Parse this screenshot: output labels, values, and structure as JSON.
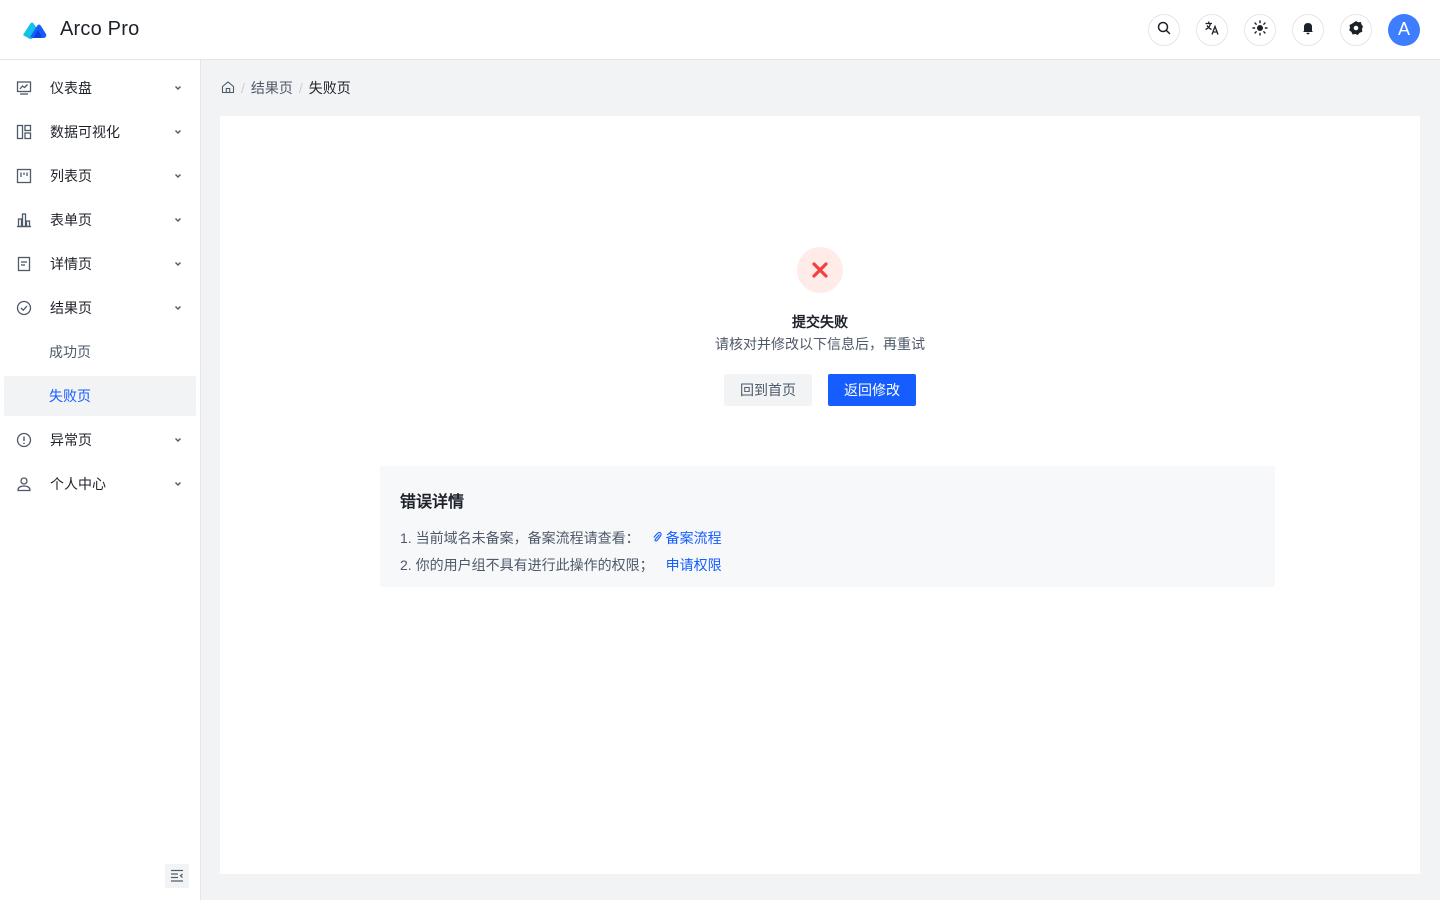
{
  "app": {
    "name": "Arco Pro",
    "avatar_letter": "A",
    "accent": "#165dff"
  },
  "toolbar": {
    "icons": [
      "search-icon",
      "translate-icon",
      "theme-icon",
      "bell-icon",
      "settings-icon"
    ]
  },
  "sidebar": {
    "items": [
      {
        "label": "仪表盘",
        "icon": "dashboard-icon"
      },
      {
        "label": "数据可视化",
        "icon": "layout-icon"
      },
      {
        "label": "列表页",
        "icon": "list-icon"
      },
      {
        "label": "表单页",
        "icon": "bar-chart-icon"
      },
      {
        "label": "详情页",
        "icon": "file-icon"
      },
      {
        "label": "结果页",
        "icon": "check-circle-icon"
      },
      {
        "label": "异常页",
        "icon": "exclamation-circle-icon"
      },
      {
        "label": "个人中心",
        "icon": "user-icon"
      }
    ],
    "result_sub": [
      {
        "label": "成功页"
      },
      {
        "label": "失败页",
        "active": true
      }
    ]
  },
  "breadcrumb": {
    "level1": "结果页",
    "level2": "失败页",
    "sep": "/"
  },
  "result": {
    "status": "error",
    "title": "提交失败",
    "subtitle": "请核对并修改以下信息后，再重试",
    "back_home": "回到首页",
    "back_edit": "返回修改",
    "error_color": "#f53f3f"
  },
  "details": {
    "title": "错误详情",
    "line1_text": "1. 当前域名未备案，备案流程请查看：",
    "line1_link": "备案流程",
    "line2_text": "2. 你的用户组不具有进行此操作的权限；",
    "line2_link": "申请权限"
  }
}
